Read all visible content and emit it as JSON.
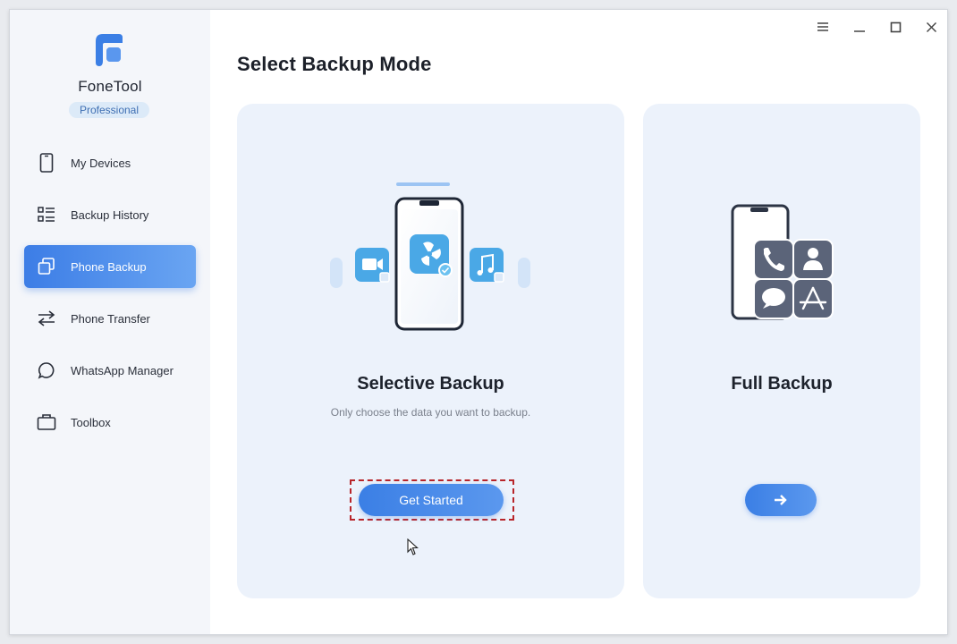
{
  "app": {
    "name": "FoneTool",
    "edition": "Professional"
  },
  "titlebar": {
    "buttons": [
      "menu-icon",
      "minimize-icon",
      "maximize-icon",
      "close-icon"
    ]
  },
  "sidebar": {
    "items": [
      {
        "label": "My Devices",
        "icon": "phone-icon"
      },
      {
        "label": "Backup History",
        "icon": "list-icon"
      },
      {
        "label": "Phone Backup",
        "icon": "backup-icon",
        "active": true
      },
      {
        "label": "Phone Transfer",
        "icon": "transfer-arrows-icon"
      },
      {
        "label": "WhatsApp Manager",
        "icon": "chat-bubble-icon"
      },
      {
        "label": "Toolbox",
        "icon": "briefcase-icon"
      }
    ]
  },
  "main": {
    "title": "Select Backup Mode",
    "cards": {
      "selective": {
        "title": "Selective Backup",
        "description": "Only choose the data you want to backup.",
        "button_label": "Get Started"
      },
      "full": {
        "title": "Full Backup",
        "button_icon": "arrow-right-icon"
      }
    }
  },
  "colors": {
    "accent": "#3c7de6",
    "card_bg": "#ecf2fb",
    "sidebar_bg": "#f4f6fa",
    "highlight_dash": "#b8252a",
    "edition_badge_bg": "#dceaf8"
  }
}
